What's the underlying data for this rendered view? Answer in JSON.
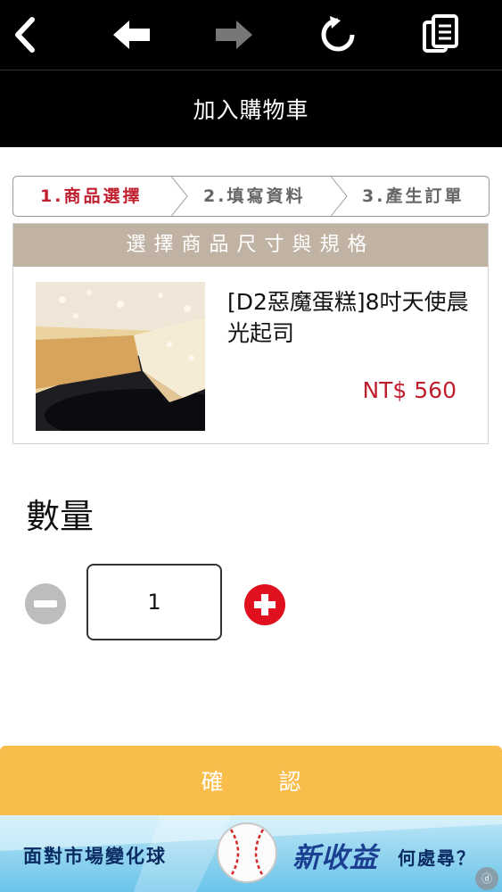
{
  "toolbar": {
    "back_icon": "chevron-left-icon",
    "nav_back_icon": "arrow-left-icon",
    "nav_forward_icon": "arrow-right-icon",
    "reload_icon": "reload-icon",
    "copy_icon": "copy-document-icon"
  },
  "header": {
    "title": "加入購物車"
  },
  "steps": [
    {
      "label": "1.商品選擇",
      "active": true
    },
    {
      "label": "2.填寫資料",
      "active": false
    },
    {
      "label": "3.產生訂單",
      "active": false
    }
  ],
  "product_panel": {
    "heading": "選擇商品尺寸與規格",
    "product_name": "[D2惡魔蛋糕]8吋天使晨光起司",
    "price": "NT$ 560"
  },
  "quantity": {
    "title": "數量",
    "value": "1"
  },
  "confirm_button": {
    "label": "確認"
  },
  "ad_banner": {
    "left_text": "面對市場變化球",
    "mid_text": "新收益",
    "right_text": "何處尋？"
  },
  "colors": {
    "accent_red": "#c01e2e",
    "confirm_yellow": "#f9bd4b",
    "panel_header": "#c1b3a4"
  }
}
